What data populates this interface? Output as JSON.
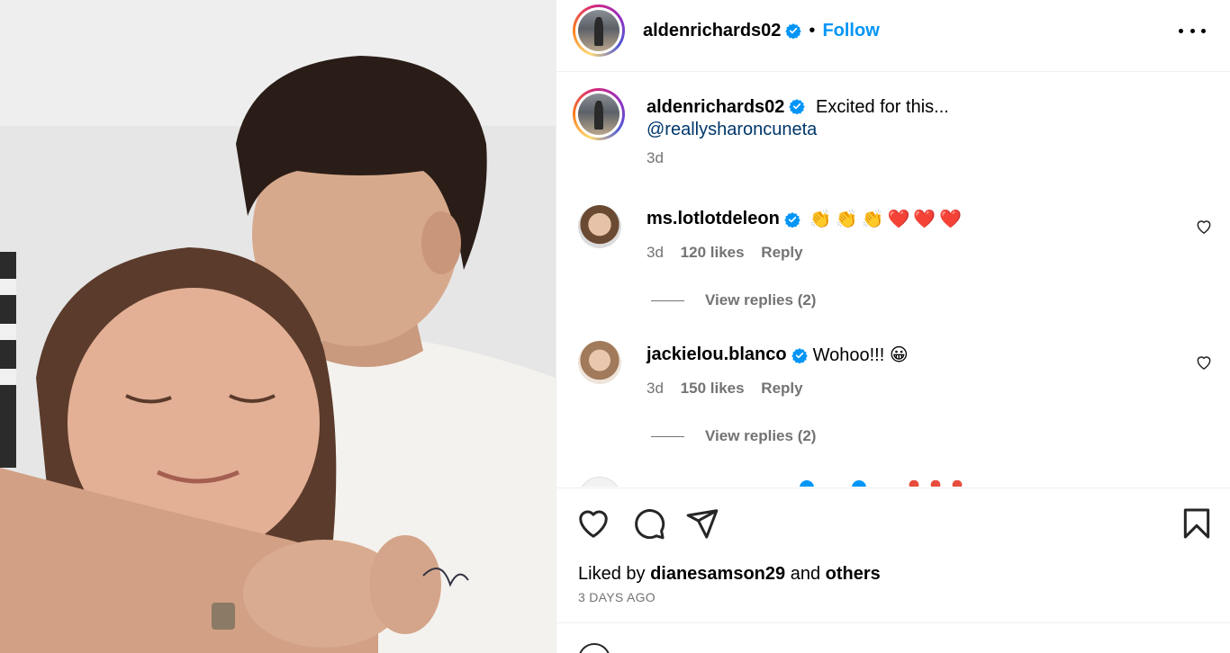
{
  "post": {
    "author": "aldenrichards02",
    "follow_label": "Follow",
    "separator": "•"
  },
  "caption": {
    "username": "aldenrichards02",
    "text": "Excited for this...",
    "mention": "@reallysharoncuneta",
    "time": "3d"
  },
  "comments": [
    {
      "username": "ms.lotlotdeleon",
      "text": "👏👏👏❤️❤️❤️",
      "time": "3d",
      "likes": "120 likes",
      "reply_label": "Reply",
      "view_replies": "View replies (2)"
    },
    {
      "username": "jackielou.blanco",
      "text": "Wohoo!!! 😀",
      "time": "3d",
      "likes": "150 likes",
      "reply_label": "Reply",
      "view_replies": "View replies (2)"
    }
  ],
  "footer": {
    "liked_by_prefix": "Liked by",
    "liked_by_user": "dianesamson29",
    "liked_by_joiner": "and",
    "liked_by_others": "others",
    "timestamp": "3 DAYS AGO"
  },
  "icons": {
    "like": "heart-icon",
    "comment": "comment-icon",
    "share": "share-icon",
    "save": "bookmark-icon",
    "more": "more-options-icon",
    "verified": "verified-badge-icon"
  },
  "colors": {
    "accent": "#0095f6",
    "verified": "#0095f6",
    "mention": "#00376b",
    "muted": "#737373"
  }
}
